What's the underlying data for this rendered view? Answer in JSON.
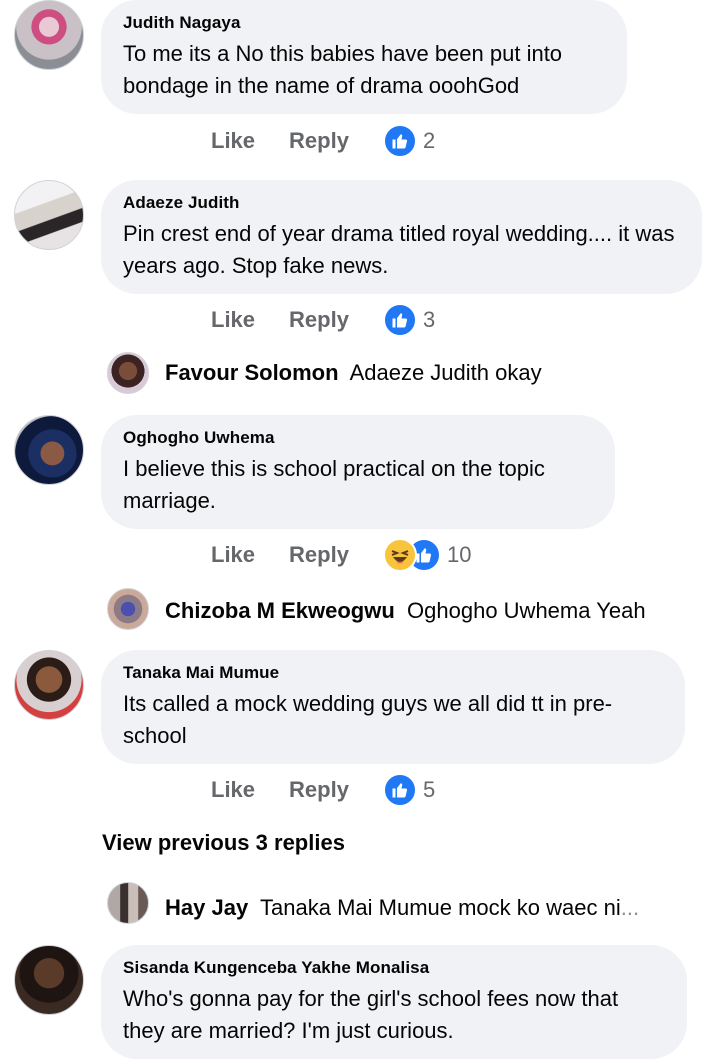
{
  "comments": [
    {
      "author": "Judith Nagaya",
      "text": "To me its a No this babies have been put into bondage in the name of drama ooohGod",
      "like_label": "Like",
      "reply_label": "Reply",
      "reaction_count": "2",
      "reactions": [
        "like-icon"
      ]
    },
    {
      "author": "Adaeze Judith",
      "text": "Pin crest end of year drama titled royal wedding.... it was years ago. Stop fake news.",
      "like_label": "Like",
      "reply_label": "Reply",
      "reaction_count": "3",
      "reactions": [
        "like-icon"
      ]
    },
    {
      "author": "Oghogho Uwhema",
      "text": "I believe this is school practical on the topic marriage.",
      "like_label": "Like",
      "reply_label": "Reply",
      "reaction_count": "10",
      "reactions": [
        "haha-icon",
        "like-icon"
      ]
    },
    {
      "author": "Tanaka Mai Mumue",
      "text": "Its called a mock wedding guys we all did tt in pre-school",
      "like_label": "Like",
      "reply_label": "Reply",
      "reaction_count": "5",
      "reactions": [
        "like-icon"
      ]
    },
    {
      "author": "Sisanda Kungenceba Yakhe Monalisa",
      "text": "Who's gonna pay for the girl's school fees now that they are married?  I'm just curious."
    }
  ],
  "replies": [
    {
      "author": "Favour Solomon",
      "text": "Adaeze Judith  okay"
    },
    {
      "author": "Chizoba M Ekweogwu",
      "text": "Oghogho Uwhema Yeah"
    },
    {
      "author": "Hay Jay",
      "text": "Tanaka Mai Mumue mock ko waec ni",
      "ellipsis": "..."
    }
  ],
  "view_previous": "View previous 3 replies",
  "colors": {
    "bubble": "#f0f2f5",
    "like_blue": "#2078f4",
    "action_gray": "#65676b",
    "haha_yellow": "#f7c43b"
  }
}
